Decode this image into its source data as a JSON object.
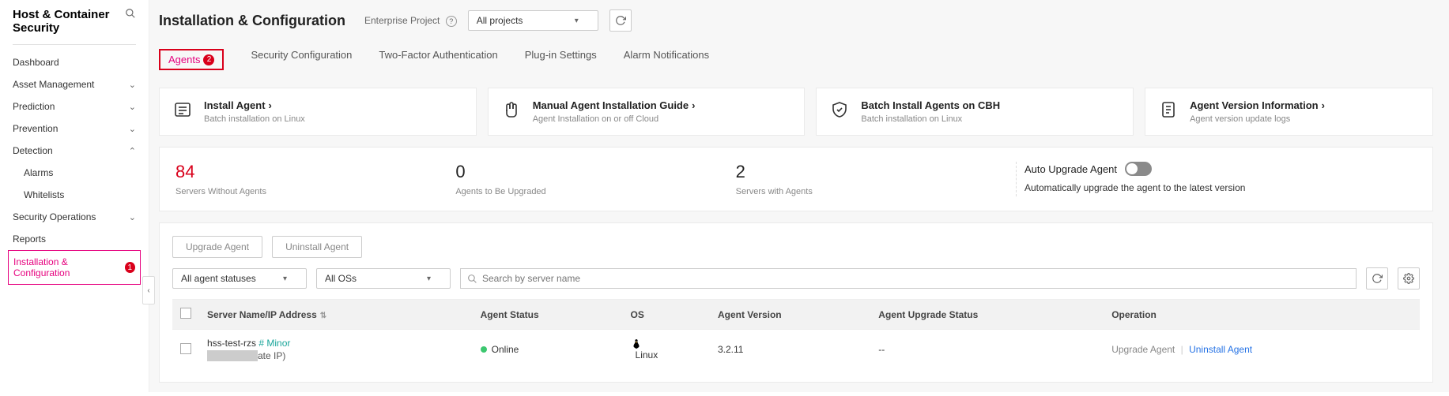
{
  "app_title": "Host & Container Security",
  "sidebar": {
    "items": [
      {
        "label": "Dashboard",
        "expandable": false
      },
      {
        "label": "Asset Management",
        "expandable": true,
        "expanded": false
      },
      {
        "label": "Prediction",
        "expandable": true,
        "expanded": false
      },
      {
        "label": "Prevention",
        "expandable": true,
        "expanded": false
      },
      {
        "label": "Detection",
        "expandable": true,
        "expanded": true
      },
      {
        "label": "Alarms",
        "indent": true
      },
      {
        "label": "Whitelists",
        "indent": true
      },
      {
        "label": "Security Operations",
        "expandable": true,
        "expanded": false
      },
      {
        "label": "Reports",
        "expandable": false
      },
      {
        "label": "Installation & Configuration",
        "active": true,
        "badge": "1"
      }
    ]
  },
  "page": {
    "title": "Installation & Configuration",
    "enterprise_label": "Enterprise Project",
    "project_select": "All projects"
  },
  "tabs": [
    {
      "label": "Agents",
      "active": true,
      "badge": "2"
    },
    {
      "label": "Security Configuration"
    },
    {
      "label": "Two-Factor Authentication"
    },
    {
      "label": "Plug-in Settings"
    },
    {
      "label": "Alarm Notifications"
    }
  ],
  "cards": [
    {
      "title": "Install Agent",
      "sub": "Batch installation on Linux",
      "icon": "list"
    },
    {
      "title": "Manual Agent Installation Guide",
      "sub": "Agent Installation on or off Cloud",
      "icon": "hand"
    },
    {
      "title": "Batch Install Agents on CBH",
      "sub": "Batch installation on Linux",
      "icon": "shield",
      "noarrow": true
    },
    {
      "title": "Agent Version Information",
      "sub": "Agent version update logs",
      "icon": "doc"
    }
  ],
  "stats": [
    {
      "num": "84",
      "label": "Servers Without Agents",
      "red": true
    },
    {
      "num": "0",
      "label": "Agents to Be Upgraded"
    },
    {
      "num": "2",
      "label": "Servers with Agents"
    }
  ],
  "auto_upgrade": {
    "title": "Auto Upgrade Agent",
    "desc": "Automatically upgrade the agent to the latest version"
  },
  "actions": {
    "upgrade": "Upgrade Agent",
    "uninstall": "Uninstall Agent"
  },
  "filters": {
    "status": "All agent statuses",
    "os": "All OSs",
    "search_placeholder": "Search by server name"
  },
  "columns": {
    "name": "Server Name/IP Address",
    "status": "Agent Status",
    "os": "OS",
    "version": "Agent Version",
    "upgrade": "Agent Upgrade Status",
    "op": "Operation"
  },
  "rows": [
    {
      "name": "hss-test-rzs",
      "tag": "# Minor",
      "ip_suffix": "ate IP)",
      "status": "Online",
      "os": "Linux",
      "version": "3.2.11",
      "upgrade": "--",
      "op_upgrade": "Upgrade Agent",
      "op_uninstall": "Uninstall Agent"
    }
  ]
}
